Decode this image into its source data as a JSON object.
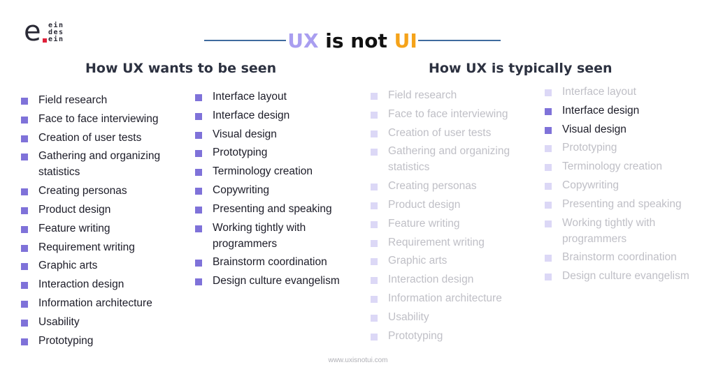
{
  "logo": {
    "letter": "e",
    "words": [
      "ein",
      "des",
      "ein"
    ]
  },
  "title": {
    "part1": "UX",
    "part2": " is not ",
    "part3": "UI"
  },
  "colors": {
    "ux": "#a99ef0",
    "ui": "#f5a31a",
    "bullet": "#7f72d9",
    "bullet_faded": "#dcd8f6",
    "line": "#3f6b9e"
  },
  "left": {
    "heading": "How UX wants to be seen",
    "col1": [
      "Field research",
      "Face to face interviewing",
      "Creation of user tests",
      "Gathering and organizing statistics",
      "Creating personas",
      "Product design",
      "Feature writing",
      "Requirement writing",
      "Graphic arts",
      "Interaction design",
      "Information architecture",
      "Usability",
      "Prototyping"
    ],
    "col2": [
      "Interface layout",
      "Interface design",
      "Visual design",
      "Prototyping",
      "Terminology creation",
      "Copywriting",
      "Presenting and speaking",
      "Working tightly with programmers",
      "Brainstorm coordination",
      "Design culture evangelism"
    ]
  },
  "right": {
    "heading": "How UX is typically seen",
    "col1": [
      "Field research",
      "Face to face interviewing",
      "Creation of user tests",
      "Gathering and organizing statistics",
      "Creating personas",
      "Product design",
      "Feature writing",
      "Requirement writing",
      "Graphic arts",
      "Interaction design",
      "Information architecture",
      "Usability",
      "Prototyping"
    ],
    "col2": [
      "Interface layout",
      "Interface design",
      "Visual design",
      "Prototyping",
      "Terminology creation",
      "Copywriting",
      "Presenting and speaking",
      "Working tightly with programmers",
      "Brainstorm coordination",
      "Design culture evangelism"
    ],
    "highlighted": [
      "Interface design",
      "Visual design"
    ]
  },
  "footer": "www.uxisnotui.com"
}
